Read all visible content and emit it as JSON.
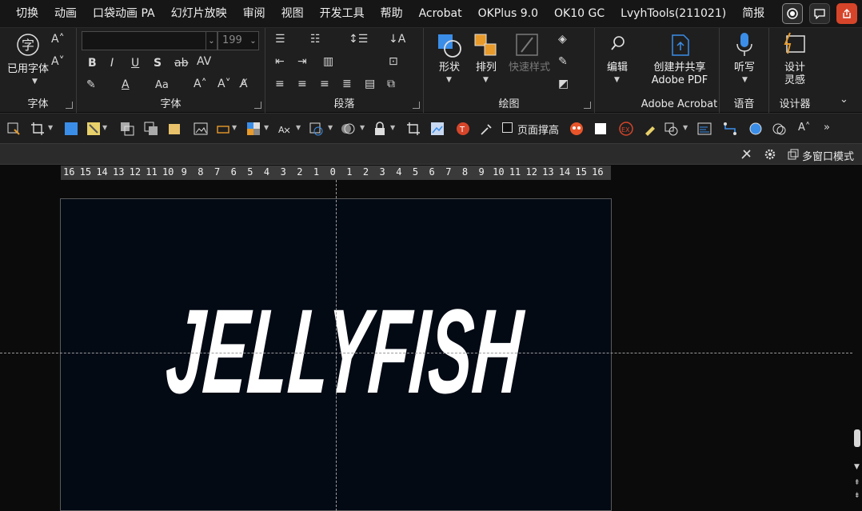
{
  "menu": {
    "items": [
      "切换",
      "动画",
      "口袋动画 PA",
      "幻灯片放映",
      "审阅",
      "视图",
      "开发工具",
      "帮助",
      "Acrobat",
      "OKPlus 9.0",
      "OK10 GC",
      "LvyhTools(211021)",
      "简报"
    ]
  },
  "ribbon": {
    "font_section": {
      "change_case_label": "已用字体",
      "group_label": "字体",
      "font_name_value": "",
      "font_size_value": "199"
    },
    "font2_group_label": "字体",
    "paragraph_group_label": "段落",
    "drawing": {
      "shape_label": "形状",
      "arrange_label": "排列",
      "quick_styles_label": "快速样式",
      "group_label": "绘图"
    },
    "editing": {
      "label": "编辑"
    },
    "acrobat": {
      "create_share_label_1": "创建并共享",
      "create_share_label_2": "Adobe PDF",
      "group_label": "Adobe Acrobat"
    },
    "voice": {
      "dictate_label": "听写",
      "group_label": "语音"
    },
    "designer": {
      "label_1": "设计",
      "label_2": "灵感",
      "group_label": "设计器"
    }
  },
  "quick_toolbar": {
    "fit_page_label": "页面撑高"
  },
  "statusbar": {
    "multi_window_label": "多窗口模式"
  },
  "ruler": {
    "ticks": [
      "16",
      "15",
      "14",
      "13",
      "12",
      "11",
      "10",
      "9",
      "8",
      "7",
      "6",
      "5",
      "4",
      "3",
      "2",
      "1",
      "0",
      "1",
      "2",
      "3",
      "4",
      "5",
      "6",
      "7",
      "8",
      "9",
      "10",
      "11",
      "12",
      "13",
      "14",
      "15",
      "16"
    ]
  },
  "slide": {
    "title_text": "JELLYFISH",
    "background_color": "#030a14",
    "text_color": "#ffffff"
  },
  "colors": {
    "accent_blue": "#3b8ee8",
    "share_button": "#d6452a",
    "orange_icon": "#e89a2a"
  }
}
